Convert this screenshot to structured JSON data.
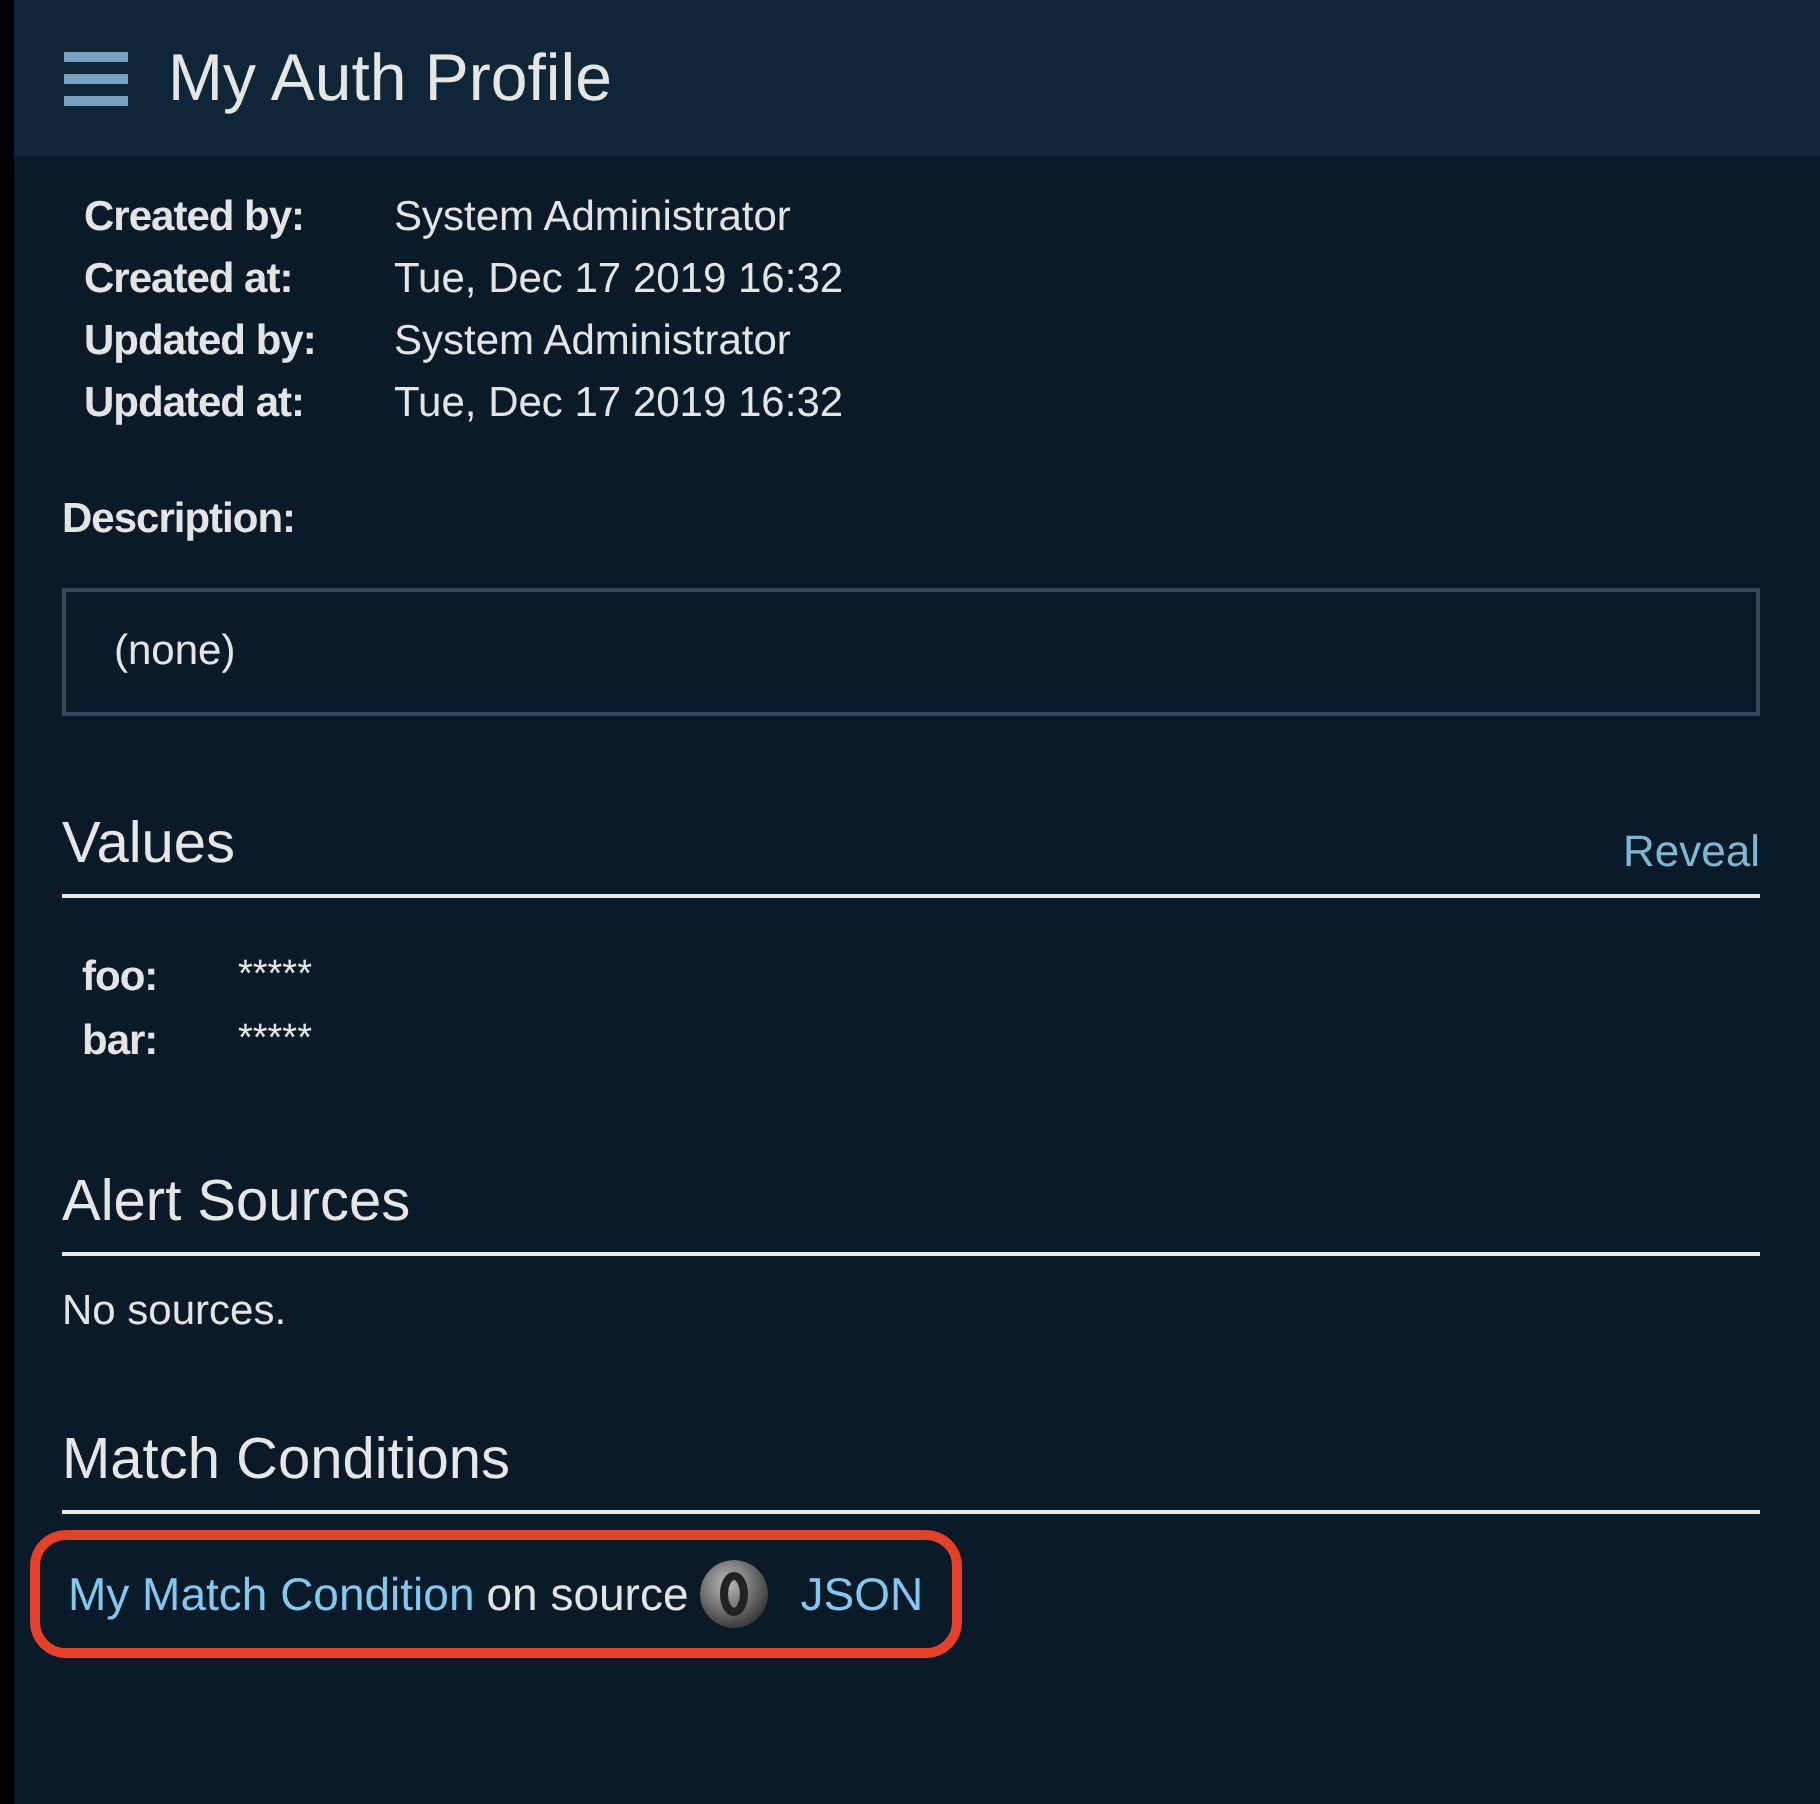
{
  "header": {
    "title": "My Auth Profile"
  },
  "meta": [
    {
      "label": "Created by:",
      "value": "System Administrator"
    },
    {
      "label": "Created at:",
      "value": "Tue, Dec 17 2019 16:32"
    },
    {
      "label": "Updated by:",
      "value": "System Administrator"
    },
    {
      "label": "Updated at:",
      "value": "Tue, Dec 17 2019 16:32"
    }
  ],
  "description": {
    "label": "Description:",
    "value": "(none)"
  },
  "values": {
    "title": "Values",
    "action": "Reveal",
    "items": [
      {
        "key": "foo:",
        "value": "*****"
      },
      {
        "key": "bar:",
        "value": "*****"
      }
    ]
  },
  "alert_sources": {
    "title": "Alert Sources",
    "empty": "No sources."
  },
  "match_conditions": {
    "title": "Match Conditions",
    "items": [
      {
        "name": "My Match Condition",
        "connector": "on source",
        "source": "JSON",
        "highlighted": true
      }
    ]
  }
}
